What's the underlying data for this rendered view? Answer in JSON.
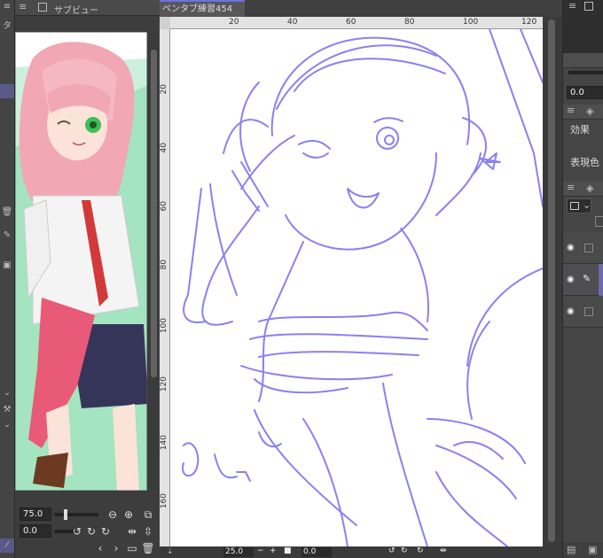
{
  "subview": {
    "tab_label": "サブビュー",
    "zoom_value": "75.0",
    "rotate_value": "0.0"
  },
  "canvas_window": {
    "tab_label": "ペンタブ練習454",
    "close_glyph": "×",
    "ruler_top": [
      "20",
      "40",
      "60",
      "80",
      "100",
      "120"
    ],
    "ruler_left": [
      "20",
      "40",
      "60",
      "80",
      "100",
      "120",
      "140",
      "160"
    ],
    "status_zoom": "25.0",
    "status_rotate": "0.0"
  },
  "right_panel": {
    "value_field": "0.0",
    "effect_label": "効果",
    "expression_label": "表現色"
  },
  "left_strip": {
    "letter": "タ"
  },
  "colors": {
    "sketch_line": "#8b80f0",
    "panel_bg": "#3a3a3a",
    "tab_accent": "#6f6fe8"
  }
}
